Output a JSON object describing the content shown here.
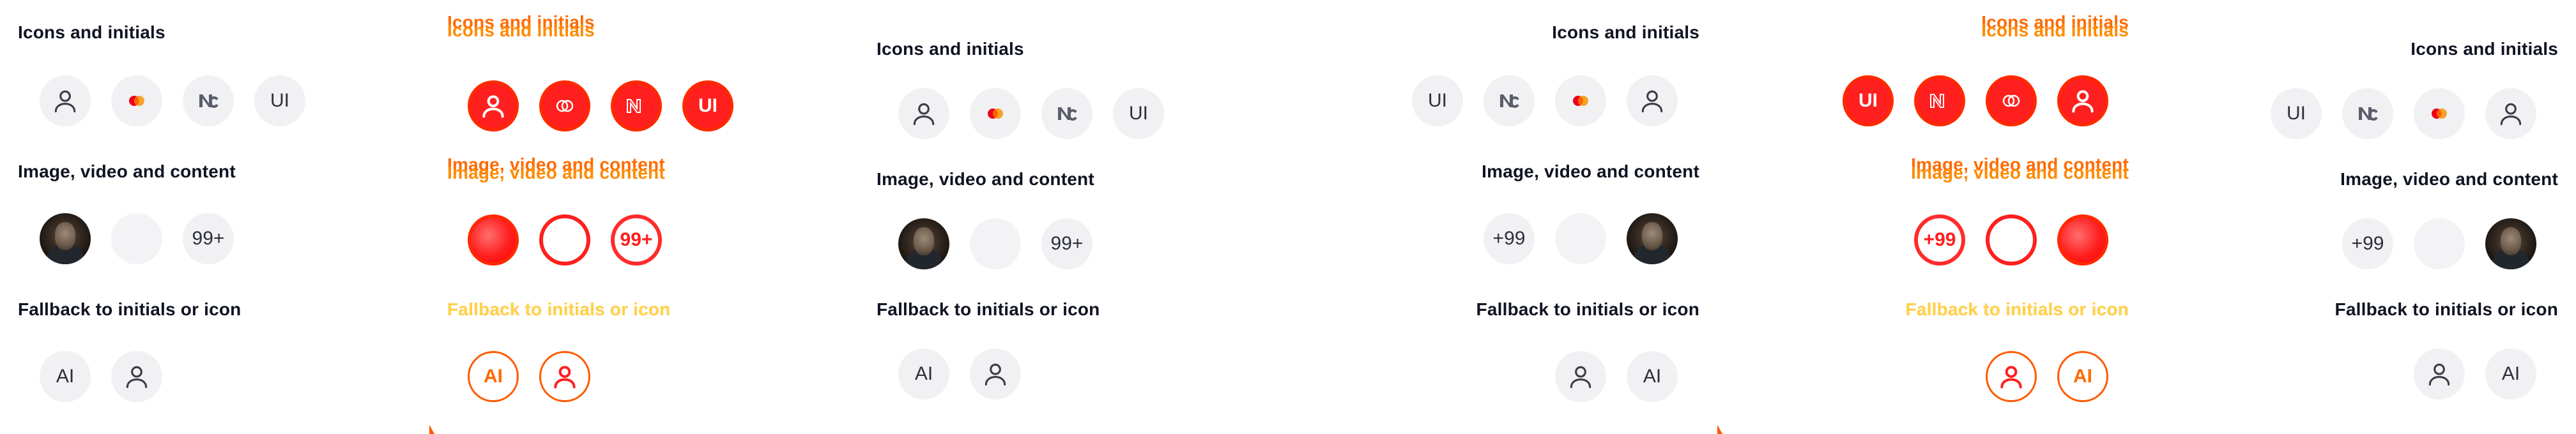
{
  "sections": {
    "icons_initials": "Icons and initials",
    "image_video_content": "Image, video and content",
    "fallback": "Fallback to initials or icon"
  },
  "avatars": {
    "initials_ui": "UI",
    "count_ltr": "99+",
    "count_rtl": "+99",
    "fallback_initials": "AI"
  },
  "icons": {
    "user": "user-icon",
    "mastercard": "mastercard-logo",
    "nc": "nc-logo",
    "photo": "portrait-photo"
  },
  "colors": {
    "text": "#101322",
    "avatar_bg": "#f1f1f4",
    "diff_red": "#ff1f1f",
    "diff_orange": "#ff8a00",
    "mastercard_red": "#eb001b",
    "mastercard_orange": "#f79e1b"
  }
}
